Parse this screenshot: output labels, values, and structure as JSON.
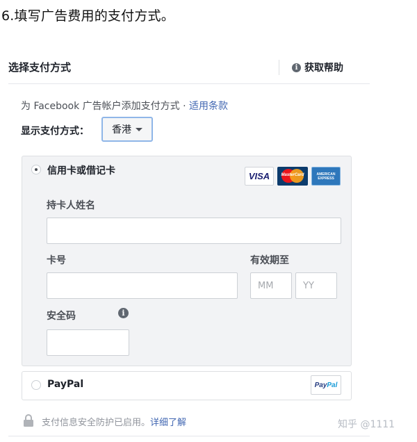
{
  "step_title": "6.填写广告费用的支付方式。",
  "header": {
    "title": "选择支付方式",
    "help_icon": "info-icon",
    "help_label": "获取帮助"
  },
  "intro": {
    "text": "为 Facebook 广告帐户添加支付方式 · ",
    "terms_link": "适用条款"
  },
  "display_region": {
    "label": "显示支付方式：",
    "selected": "香港"
  },
  "card_option": {
    "label": "信用卡或借记卡",
    "selected": true,
    "logos": {
      "visa": "VISA",
      "mastercard": "MasterCard",
      "amex_line1": "AMERICAN",
      "amex_line2": "EXPRESS"
    },
    "cardholder_label": "持卡人姓名",
    "cardholder_value": "",
    "card_number_label": "卡号",
    "card_number_value": "",
    "expiry_label": "有效期至",
    "month_placeholder": "MM",
    "year_placeholder": "YY",
    "security_code_label": "安全码",
    "security_code_value": ""
  },
  "paypal_option": {
    "label": "PayPal",
    "selected": false,
    "logo_pay": "Pay",
    "logo_pal": "Pal"
  },
  "security_notice": {
    "text": "支付信息安全防护已启用。",
    "learn_more": "详细了解"
  },
  "watermark": "知乎 @1111",
  "colors": {
    "link": "#4267b2",
    "panel_bg": "#f2f3f5",
    "border": "#dddfe2",
    "select_border": "#8fb6e8"
  }
}
